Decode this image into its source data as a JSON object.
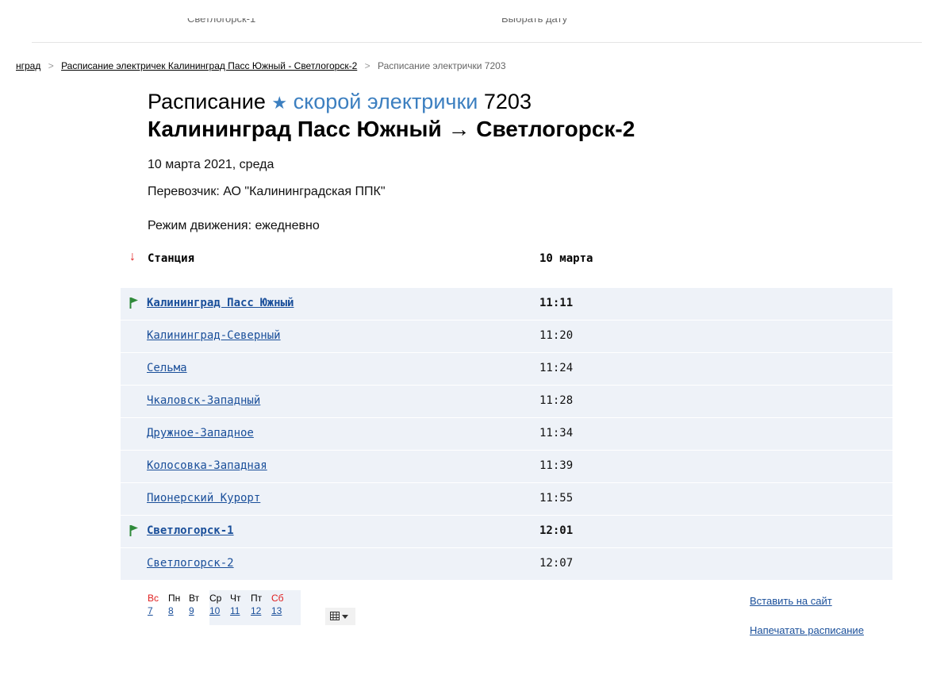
{
  "search": {
    "from_value": "Светлогорск-1",
    "date_value": "Выбрать дату"
  },
  "breadcrumbs": {
    "items": [
      "нград",
      "Расписание электричек Калининград Пасс Южный - Светлогорск-2",
      "Расписание электрички 7203"
    ],
    "separator": ">"
  },
  "title": {
    "prefix": "Расписание",
    "star": "★",
    "kind": "скорой электрички",
    "number": "7203",
    "route": "Калининград Пасс Южный → Светлогорск-2"
  },
  "meta": {
    "date": "10 марта 2021, среда",
    "carrier": "Перевозчик: АО \"Калининградская ППК\"",
    "mode": "Режим движения: ежедневно"
  },
  "table": {
    "sort_arrow": "↓",
    "header_station": "Станция",
    "header_date": "10 марта",
    "rows": [
      {
        "station": "Калининград Пасс Южный",
        "time": "11:11",
        "bold": true,
        "flag": true
      },
      {
        "station": "Калининград-Северный",
        "time": "11:20",
        "bold": false,
        "flag": false
      },
      {
        "station": "Сельма",
        "time": "11:24",
        "bold": false,
        "flag": false
      },
      {
        "station": "Чкаловск-Западный",
        "time": "11:28",
        "bold": false,
        "flag": false
      },
      {
        "station": "Дружное-Западное",
        "time": "11:34",
        "bold": false,
        "flag": false
      },
      {
        "station": "Колосовка-Западная",
        "time": "11:39",
        "bold": false,
        "flag": false
      },
      {
        "station": "Пионерский Курорт",
        "time": "11:55",
        "bold": false,
        "flag": false
      },
      {
        "station": "Светлогорск-1",
        "time": "12:01",
        "bold": true,
        "flag": true
      },
      {
        "station": "Светлогорск-2",
        "time": "12:07",
        "bold": false,
        "flag": false
      }
    ]
  },
  "calendar": {
    "days": [
      {
        "label": "Вс",
        "weekend": true
      },
      {
        "label": "Пн",
        "weekend": false
      },
      {
        "label": "Вт",
        "weekend": false
      },
      {
        "label": "Ср",
        "weekend": false
      },
      {
        "label": "Чт",
        "weekend": false
      },
      {
        "label": "Пт",
        "weekend": false
      },
      {
        "label": "Сб",
        "weekend": true
      }
    ],
    "dates": [
      "7",
      "8",
      "9",
      "10",
      "11",
      "12",
      "13"
    ],
    "menu_icon": "calendar-grid-icon"
  },
  "links": {
    "embed": "Вставить на сайт",
    "print": "Напечатать расписание"
  },
  "colors": {
    "accent": "#3c7fc0",
    "link": "#1a4f9a",
    "row_bg": "#eef2f8",
    "flag": "#2f8a3a",
    "weekend": "#e02020"
  }
}
